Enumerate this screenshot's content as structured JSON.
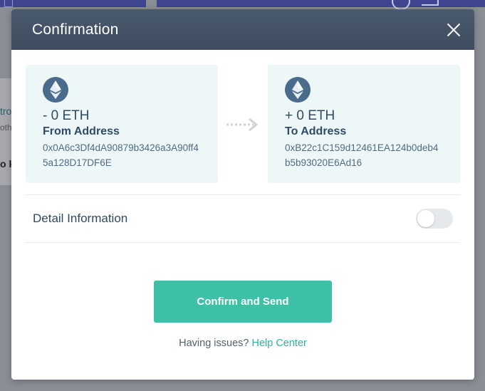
{
  "background": {
    "text_fragments": [
      "tro",
      "oth",
      "o k"
    ]
  },
  "modal": {
    "title": "Confirmation",
    "from": {
      "amount": "- 0 ETH",
      "label": "From Address",
      "address": "0x0A6c3Df4dA90879b3426a3A90ff45a128D17DF6E"
    },
    "to": {
      "amount": "+ 0 ETH",
      "label": "To Address",
      "address": "0xB22c1C159d12461EA124b0deb4b5b93020E6Ad16"
    },
    "detail": {
      "label": "Detail Information",
      "toggle_on": false
    },
    "confirm_label": "Confirm and Send",
    "help_text": "Having issues?",
    "help_link": "Help Center"
  },
  "colors": {
    "header": "#3e4c5e",
    "accent": "#3dc0a5",
    "card_bg": "#eef7f7"
  },
  "icons": [
    "ethereum-icon",
    "close-icon",
    "arrow-right-icon"
  ]
}
